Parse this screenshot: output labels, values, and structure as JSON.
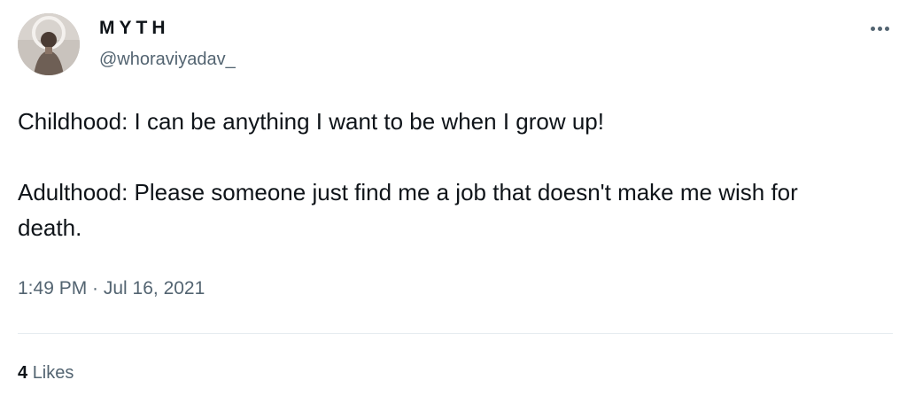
{
  "author": {
    "display_name": "MYTH",
    "handle": "@whoraviyadav_"
  },
  "tweet": {
    "paragraphs": [
      "Childhood: I can be anything I want to be when I grow up!",
      "Adulthood: Please someone just find me a job that doesn't make me wish for death."
    ],
    "timestamp": "1:49 PM · Jul 16, 2021"
  },
  "stats": {
    "likes_count": "4",
    "likes_label": "Likes"
  },
  "icons": {
    "more": "more-options-icon"
  },
  "colors": {
    "primary_text": "#0f1419",
    "secondary_text": "#536471",
    "divider": "#e6ecf0"
  }
}
